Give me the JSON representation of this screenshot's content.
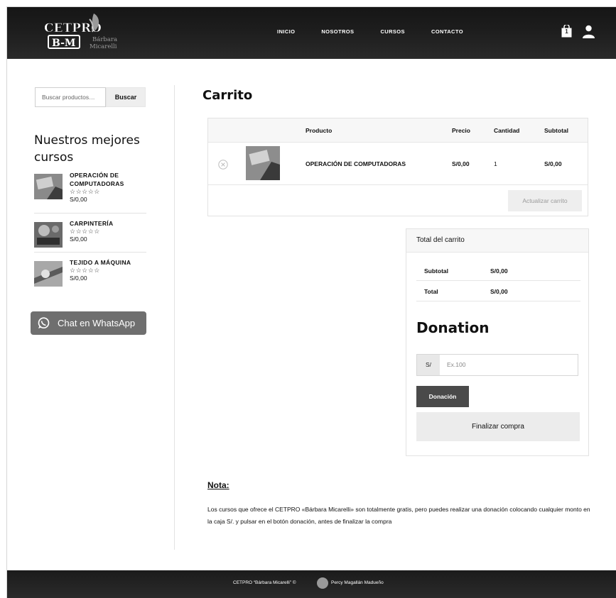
{
  "header": {
    "logo_text": "CETPRO",
    "logo_initials": "B-M",
    "logo_name_line1": "Bárbara",
    "logo_name_line2": "Micarelli",
    "nav": [
      "INICIO",
      "NOSOTROS",
      "CURSOS",
      "CONTACTO"
    ],
    "cart_count": "1",
    "icons": [
      "cart-icon",
      "user-icon"
    ]
  },
  "sidebar": {
    "search_placeholder": "Buscar productos…",
    "search_button": "Buscar",
    "widget_title": "Nuestros mejores cursos",
    "products": [
      {
        "name": "OPERACIÓN DE COMPUTADORAS",
        "stars": "☆☆☆☆☆",
        "price": "S/0,00"
      },
      {
        "name": "CARPINTERÍA",
        "stars": "☆☆☆☆☆",
        "price": "S/0,00"
      },
      {
        "name": "TEJIDO A MÁQUINA",
        "stars": "☆☆☆☆☆",
        "price": "S/0,00"
      }
    ],
    "whatsapp_label": "Chat en WhatsApp"
  },
  "main": {
    "title": "Carrito",
    "table": {
      "headers": [
        "Producto",
        "Precio",
        "Cantidad",
        "Subtotal"
      ],
      "rows": [
        {
          "product": "OPERACIÓN DE COMPUTADORAS",
          "price": "S/0,00",
          "qty": "1",
          "subtotal": "S/0,00"
        }
      ],
      "update_button": "Actualizar carrito"
    },
    "totals": {
      "title": "Total del carrito",
      "rows": [
        {
          "label": "Subtotal",
          "value": "S/0,00"
        },
        {
          "label": "Total",
          "value": "S/0,00"
        }
      ],
      "donation_title": "Donation",
      "donation_currency": "S/",
      "donation_placeholder": "Ex.100",
      "donation_button": "Donación",
      "checkout_button": "Finalizar compra"
    },
    "note_title": "Nota:",
    "note_text": "Los cursos que ofrece el CETPRO «Bárbara Micarelli» son totalmente gratis, pero puedes realizar una donación colocando cualquier monto en la caja  S/. y pulsar en el botón donación, antes de finalizar la compra"
  },
  "footer": {
    "text": "CETPRO “Bárbara Micarelli” ©",
    "author": "Percy Magallán Madueño"
  },
  "colors": {
    "header_bg": "#1d1d1d",
    "button_dark": "#4a4a4a",
    "button_light": "#eeeeee",
    "whatsapp_bg": "#6f6f6f"
  }
}
